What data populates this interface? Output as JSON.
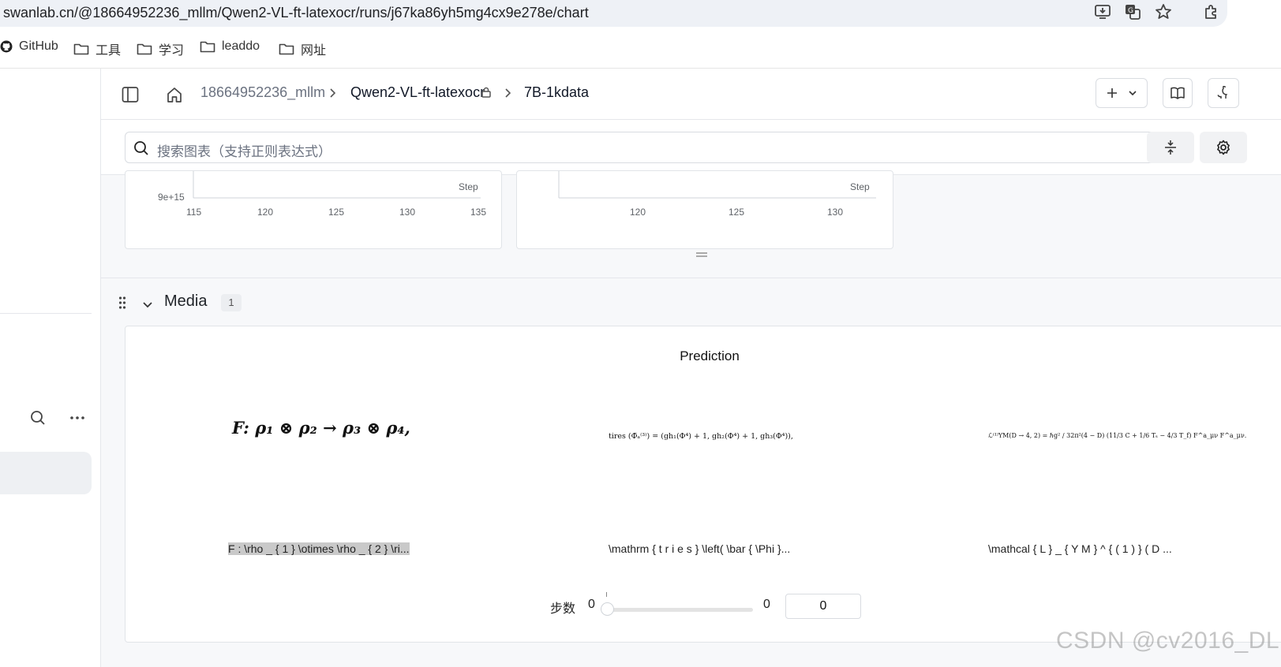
{
  "browser": {
    "url": "swanlab.cn/@18664952236_mllm/Qwen2-VL-ft-latexocr/runs/j67ka86yh5mg4cx9e278e/chart",
    "bookmarks": [
      "GitHub",
      "工具",
      "学习",
      "leaddo",
      "网址"
    ]
  },
  "header": {
    "breadcrumb": [
      "18664952236_mllm",
      "Qwen2-VL-ft-latexocr",
      "7B-1kdata"
    ]
  },
  "search": {
    "placeholder": "搜索图表（支持正则表达式）"
  },
  "charts": [
    {
      "y_tick": "9e+15",
      "x_ticks": [
        "115",
        "120",
        "125",
        "130",
        "135"
      ],
      "x_label": "Step"
    },
    {
      "x_ticks": [
        "120",
        "125",
        "130"
      ],
      "x_label": "Step"
    }
  ],
  "media": {
    "section_title": "Media",
    "count": "1",
    "panel_title": "Prediction",
    "items": [
      {
        "formula": "F: ρ₁ ⊗ ρ₂ → ρ₃ ⊗ ρ₄,",
        "caption": "F : \\rho _ { 1 } \\otimes \\rho _ { 2 } \\ri..."
      },
      {
        "formula": "tires (Φ̄ₐ⁽³⁾) = (gh₁(Φ⁴) + 1, gh₂(Φ⁴) + 1, gh₃(Φ⁴)),",
        "caption": "\\mathrm { t r i e s } \\left( \\bar { \\Phi }..."
      },
      {
        "formula": "ℒ⁽¹⁾YM(D → 4, 2) = ℏg² / 32π²(4 − D) (11/3 C + 1/6 Tₛ − 4/3 T_f) F^a_μν F^a_μν.",
        "caption": "\\mathcal { L } _ { Y M } ^ { ( 1 ) } ( D ..."
      }
    ],
    "step_label": "步数",
    "step_min": "0",
    "step_max": "0",
    "step_value": "0"
  },
  "watermark": "CSDN @cv2016_DL"
}
